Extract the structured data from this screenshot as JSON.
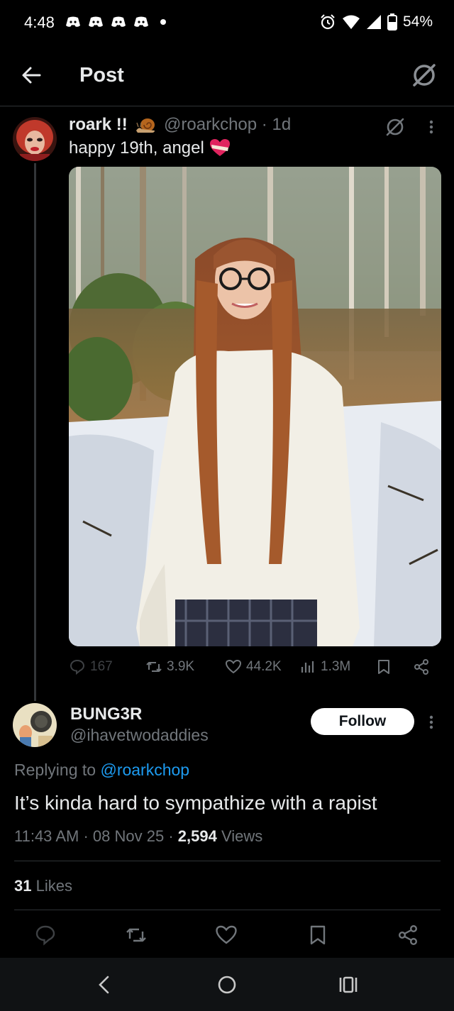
{
  "status_bar": {
    "time": "4:48",
    "battery": "54%",
    "notification_icons": [
      "discord-icon",
      "discord-icon",
      "discord-icon",
      "discord-icon"
    ]
  },
  "header": {
    "title": "Post"
  },
  "original_post": {
    "display_name": "roark !!",
    "handle": "@roarkchop",
    "age": "1d",
    "text": "happy 19th, angel",
    "stats": {
      "replies": "167",
      "reposts": "3.9K",
      "likes": "44.2K",
      "views": "1.3M"
    }
  },
  "reply_post": {
    "display_name": "BUNG3R",
    "handle": "@ihavetwodaddies",
    "follow_label": "Follow",
    "replying_prefix": "Replying to",
    "replying_handle": "@roarkchop",
    "text": "It’s kinda hard to sympathize with a rapist",
    "time": "11:43 AM",
    "date": "08 Nov 25",
    "views_count": "2,594",
    "views_label": "Views",
    "likes_count": "31",
    "likes_label": "Likes"
  },
  "colors": {
    "background": "#000000",
    "text_primary": "#e7e9ea",
    "text_secondary": "#71767b",
    "link": "#1d9bf0",
    "divider": "#2f3336"
  }
}
